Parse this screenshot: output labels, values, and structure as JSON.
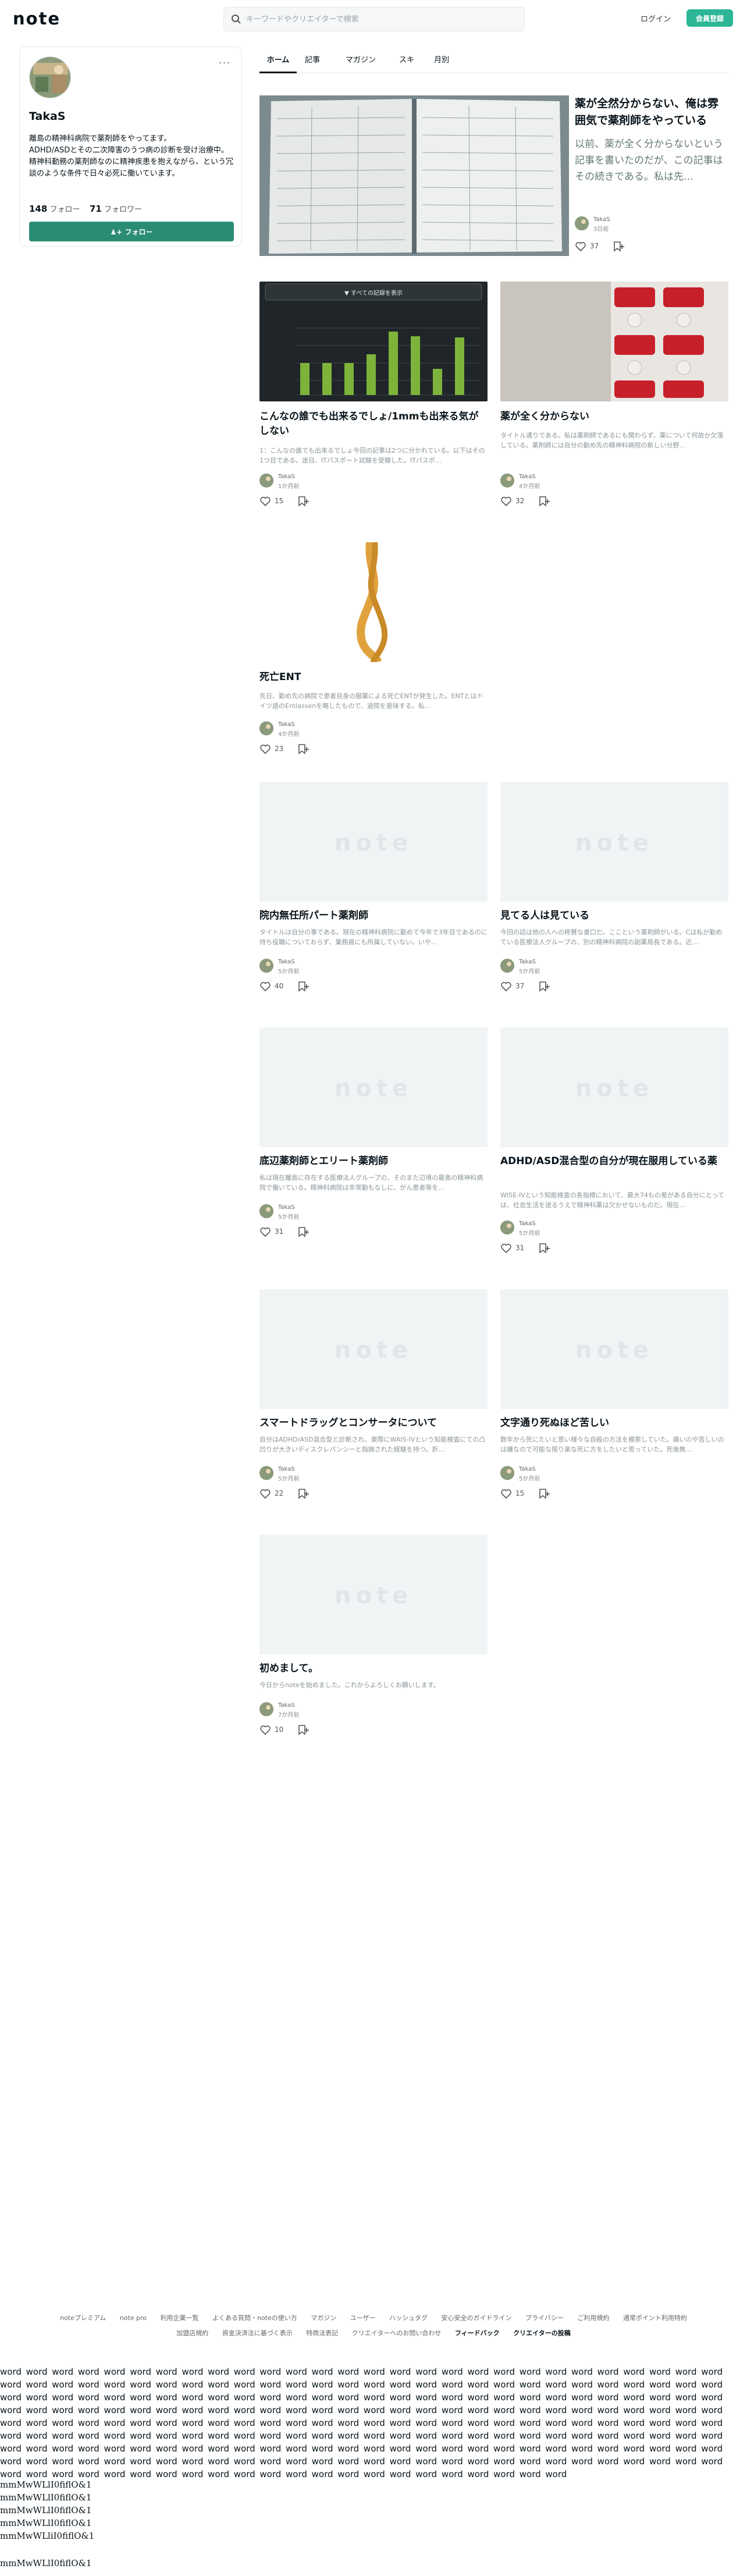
{
  "header": {
    "logo": "note",
    "search_placeholder": "キーワードやクリエイターで検索",
    "login_label": "ログイン",
    "signup_label": "会員登録"
  },
  "profile": {
    "name": "TakaS",
    "bio": "離島の精神科病院で薬剤師をやってます。\nADHD/ASDとその二次障害のうつ病の診断を受け治療中。\n精神科勤務の薬剤師なのに精神疾患を抱えながら、という冗談のような条件で日々必死に働いています。",
    "follow_count": "148",
    "follow_label": "フォロー",
    "follower_count": "71",
    "follower_label": "フォロワー",
    "follow_button": "フォロー",
    "more_label": "···"
  },
  "tabs": [
    {
      "label": "ホーム",
      "active": true
    },
    {
      "label": "記事",
      "active": false
    },
    {
      "label": "マガジン",
      "active": false
    },
    {
      "label": "スキ",
      "active": false
    },
    {
      "label": "月別",
      "active": false
    }
  ],
  "featured": {
    "title": "薬が全然分からない、俺は雰囲気で薬剤師をやっている",
    "excerpt": "以前、薬が全く分からないという記事を書いたのだが、この記事はその続きである。私は先…",
    "author": "TakaS",
    "time": "3日前",
    "likes": "37"
  },
  "chart_thumb": {
    "show_all": "▼ すべての記録を表示"
  },
  "cards": [
    {
      "title": "こんなの誰でも出来るでしょ/1mmも出来る気がしない",
      "excerpt": "1：こんなの誰でも出来るでしょ今回の記事は2つに分かれている。以下はその1つ目である。途日、ITパスポート試験を受験した。ITパスポ…",
      "author": "TakaS",
      "time": "1か月前",
      "likes": "15"
    },
    {
      "title": "薬が全く分からない",
      "excerpt": "タイトル通りである。私は薬剤師であるにも関わらず、薬について何故か欠落している。薬剤師には自分の勤め先の精神科病院の新しい分野…",
      "author": "TakaS",
      "time": "4か月前",
      "likes": "32"
    },
    {
      "title": "死亡ENT",
      "excerpt": "先日、勤め先の病院で患者自身の服薬による死亡ENTが発生した。ENTとはドイツ語のEntlassenを略したもので、退院を意味する。私…",
      "author": "TakaS",
      "time": "4か月前",
      "likes": "23"
    },
    {
      "title": "院内無任所パート薬剤師",
      "excerpt": "タイトルは自分の事である。現在の精神科病院に勤めて今年で3年目であるのに持ち役職についておらず、業務員にも所属していない。いや…",
      "author": "TakaS",
      "time": "5か月前",
      "likes": "40"
    },
    {
      "title": "見てる人は見ている",
      "excerpt": "今回の話は他の人への称賛な書口だ。ここという薬剤師がいる。Cは私が勤めている医療法人グループの、別の精神科病院の副薬局長である。近…",
      "author": "TakaS",
      "time": "5か月前",
      "likes": "37"
    },
    {
      "title": "底辺薬剤師とエリート薬剤師",
      "excerpt": "私は現在離島に存在する医療法人グループの、そのまた辺境の最奥の精神科病院で働いている。精神科病院は非常勤もなしに、がん患者等を…",
      "author": "TakaS",
      "time": "5か月前",
      "likes": "31"
    },
    {
      "title": "ADHD/ASD混合型の自分が現在服用している薬",
      "excerpt": "WISE-IVという知能検査の各指標において、最大74もの差がある自分にとっては、社会生活を送るうえで精神科薬は欠かせないものだ。現在…",
      "author": "TakaS",
      "time": "5か月前",
      "likes": "31"
    },
    {
      "title": "スマートドラッグとコンサータについて",
      "excerpt": "自分はADHD/ASD混合型と診断され、東際にWAIS-IVという知能検査にての凸凹りが大きいディスクレパンシーと指摘された経験を持つ。折…",
      "author": "TakaS",
      "time": "5か月前",
      "likes": "22"
    },
    {
      "title": "文字通り死ぬほど苦しい",
      "excerpt": "数年から死にたいと思い様々な自殺の方法を模索していた。痛いのや苦しいのは嫌なので可能な限り楽な死に方をしたいと思っていた。死後無…",
      "author": "TakaS",
      "time": "5か月前",
      "likes": "15"
    },
    {
      "title": "初めまして。",
      "excerpt": "今日からnoteを始めました。これからよろしくお願いします。",
      "author": "TakaS",
      "time": "7か月前",
      "likes": "10"
    }
  ],
  "placeholder_logo": "note",
  "footer_links": [
    "noteプレミアム",
    "note pro",
    "利用企業一覧",
    "よくある質問・noteの使い方",
    "マガジン",
    "ユーザー",
    "ハッシュタグ",
    "安心安全のガイドライン",
    "プライバシー",
    "ご利用規約",
    "通常ポイント利用特約",
    "加盟店規約",
    "資金決済法に基づく表示",
    "特商法表記",
    "クリエイターへのお問い合わせ",
    "フィードバック",
    "クリエイターの投稿"
  ],
  "word_block": "word word word word word word word word word word word word word word word word word word word word word word word word word word word word word word word word word word word word word word word word word word word word word word word word word word word word word word word word word word word word word word word word word word word word word word word word word word word word word word word word word word word word word word word word word word word word word word word word word word word word word word word word word word word word word word word word word word word word word word word word word word word word word word word word word word word word word word word word word word word word word word word word word word word word word word word word word word word word word word word word word word word word word word word word word word word word word word word word word word word word word word word word word word word word word word word word word word word word word word word word word word word word word word word word word word word word word word word word word word word word word word word word word word word word word word word word word word word word word word word word word word word word word word",
  "glyph_lines": [
    "mmMwWLlI0fiflO&1",
    "mmMwWLlI0fiflO&1",
    "mmMwWLlI0fiflO&1",
    "mmMwWLlI0fiflO&1",
    "mmMwWLliI0fiflO&1"
  ],
  "glyph_last": "mmMwWLlI0fiflO&1",
  "colors": {
    "accent": "#2cb696",
    "follow": "#2b8c74",
    "text": "#08131a"
  }
}
